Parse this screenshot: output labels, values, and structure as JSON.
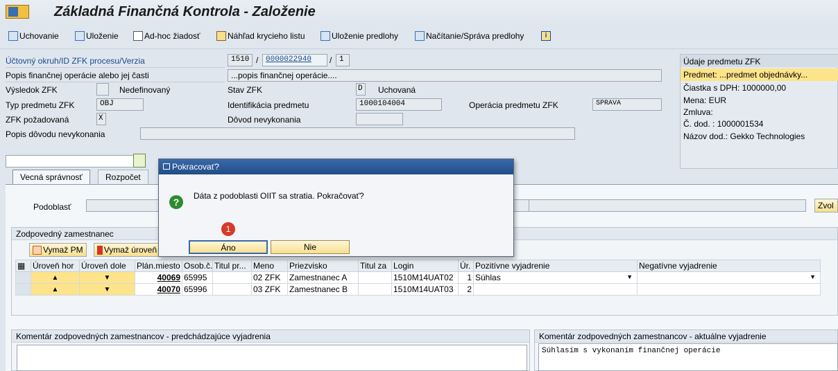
{
  "window": {
    "title": "Základná Finančná Kontrola - Založenie"
  },
  "toolbar": {
    "uchovanie": "Uchovanie",
    "ulozenie": "Uloženie",
    "adhoc": "Ad-hoc žiadosť",
    "nahlad": "Náhľad krycieho listu",
    "ulozenie_predlohy": "Uloženie predlohy",
    "nacitanie": "Načítanie/Správa predlohy"
  },
  "header": {
    "uctovny_label": "Účtovný okruh/ID ZFK procesu/Verzia",
    "okruh": "1510",
    "id_zfk": "0000022940",
    "verzia": "1",
    "slash": "/",
    "popis_label": "Popis finančnej operácie alebo jej časti",
    "popis_value": "...popis finančnej operácie....",
    "vysledok_label": "Výsledok ZFK",
    "vysledok_value": "Nedefinovaný",
    "stav_label": "Stav ZFK",
    "stav_code": "D",
    "stav_value": "Uchovaná",
    "typ_label": "Typ predmetu ZFK",
    "typ_value": "OBJ",
    "identifikacia_label": "Identifikácia predmetu",
    "identifikacia_value": "1000104004",
    "operacia_label": "Operácia predmetu ZFK",
    "operacia_value": "SPRAVA",
    "pozadovana_label": "ZFK požadovaná",
    "pozadovana_value": "X",
    "dovod_label": "Dôvod nevykonania",
    "popis_dovodu_label": "Popis dôvodu nevykonania"
  },
  "side_panel": {
    "header": "Údaje predmetu ZFK",
    "predmet": "Predmet: ...predmet objednávky...",
    "ciastka": "Čiastka s DPH:    1000000,00",
    "mena": "Mena: EUR",
    "zmluva": "Zmluva:",
    "dodavatel": "Č. dod. : 1000001534",
    "nazov": "Názov dod.: Gekko Technologies"
  },
  "tabs": [
    "Vecná správnosť",
    "Rozpočet"
  ],
  "vecna": {
    "podoblast_label": "Podoblasť",
    "zvol": "Zvol",
    "group_title": "Zodpovedný zamestnanec",
    "btn_vymaz_pm": "Vymaž PM",
    "btn_vymaz_uroven": "Vymaž úroveň",
    "columns": [
      "Úroveň hor",
      "Úroveň dole",
      "Plán.miesto",
      "Osob.č.",
      "Titul pr...",
      "Meno",
      "Priezvisko",
      "Titul za",
      "Login",
      "Úr.",
      "Pozitívne vyjadrenie",
      "Negatívne vyjadrenie"
    ],
    "rows": [
      {
        "up": "▲",
        "down": "▼",
        "plan": "40069",
        "osob": "65995",
        "titul": "",
        "meno": "02 ZFK",
        "priezvisko": "Zamestnanec A",
        "titul_za": "",
        "login": "1510M14UAT02",
        "ur": "1",
        "pozitivne": "Súhlas",
        "negativne": ""
      },
      {
        "up": "▲",
        "down": "▼",
        "plan": "40070",
        "osob": "65996",
        "titul": "",
        "meno": "03 ZFK",
        "priezvisko": "Zamestnanec B",
        "titul_za": "",
        "login": "1510M14UAT03",
        "ur": "2",
        "pozitivne": "",
        "negativne": ""
      }
    ],
    "komentar_pred_title": "Komentár zodpovedných zamestnancov - predchádzajúce vyjadrenia",
    "komentar_akt_title": "Komentár zodpovedných zamestnancov - aktuálne vyjadrenie",
    "komentar_akt_text": "Súhlasím s vykonaním finančnej operácie"
  },
  "dialog": {
    "title": "Pokracovať?",
    "message": "Dáta z podoblasti OIIT sa stratia. Pokračovať?",
    "yes": "Áno",
    "no": "Nie",
    "badge": "1"
  },
  "colors": {
    "accent": "#214d88",
    "button_yellow": "#f7df90",
    "highlight": "#fde48a"
  }
}
